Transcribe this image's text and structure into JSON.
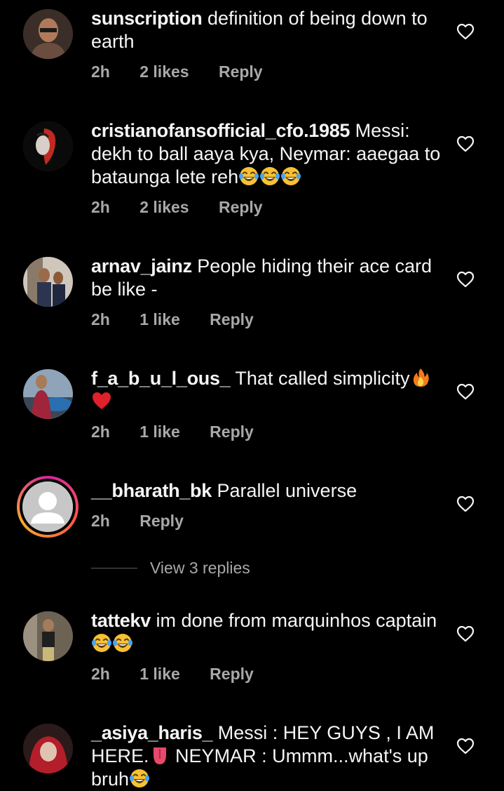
{
  "comments": [
    {
      "username": "sunscription",
      "text": "definition of being down to earth",
      "time": "2h",
      "likes": "2 likes",
      "reply": "Reply"
    },
    {
      "username": "cristianofansofficial_cfo.1985",
      "text": "Messi: dekh to ball aaya kya, Neymar: aaegaa to bataunga lete reh",
      "time": "2h",
      "likes": "2 likes",
      "reply": "Reply"
    },
    {
      "username": "arnav_jainz",
      "text": "People hiding their ace card be like -",
      "time": "2h",
      "likes": "1 like",
      "reply": "Reply"
    },
    {
      "username": "f_a_b_u_l_ous_",
      "text": "That called simplicity",
      "time": "2h",
      "likes": "1 like",
      "reply": "Reply"
    },
    {
      "username": "__bharath_bk",
      "text": "Parallel universe",
      "time": "2h",
      "reply": "Reply",
      "view_replies": "View 3 replies"
    },
    {
      "username": "tattekv",
      "text": "im done from marquinhos captain",
      "time": "2h",
      "likes": "1 like",
      "reply": "Reply"
    },
    {
      "username": "_asiya_haris_",
      "text_a": "Messi : HEY GUYS , I AM HERE.",
      "text_b": "NEYMAR : Ummm...what's up bruh"
    }
  ],
  "icons": {
    "like": "heart-outline-icon",
    "laugh": "tears-of-joy-emoji",
    "fire": "fire-emoji",
    "heart": "red-heart-emoji",
    "tongue": "tongue-emoji"
  },
  "colors": {
    "background": "#000000",
    "text": "#f5f5f5",
    "secondary": "#a8a8a8"
  }
}
